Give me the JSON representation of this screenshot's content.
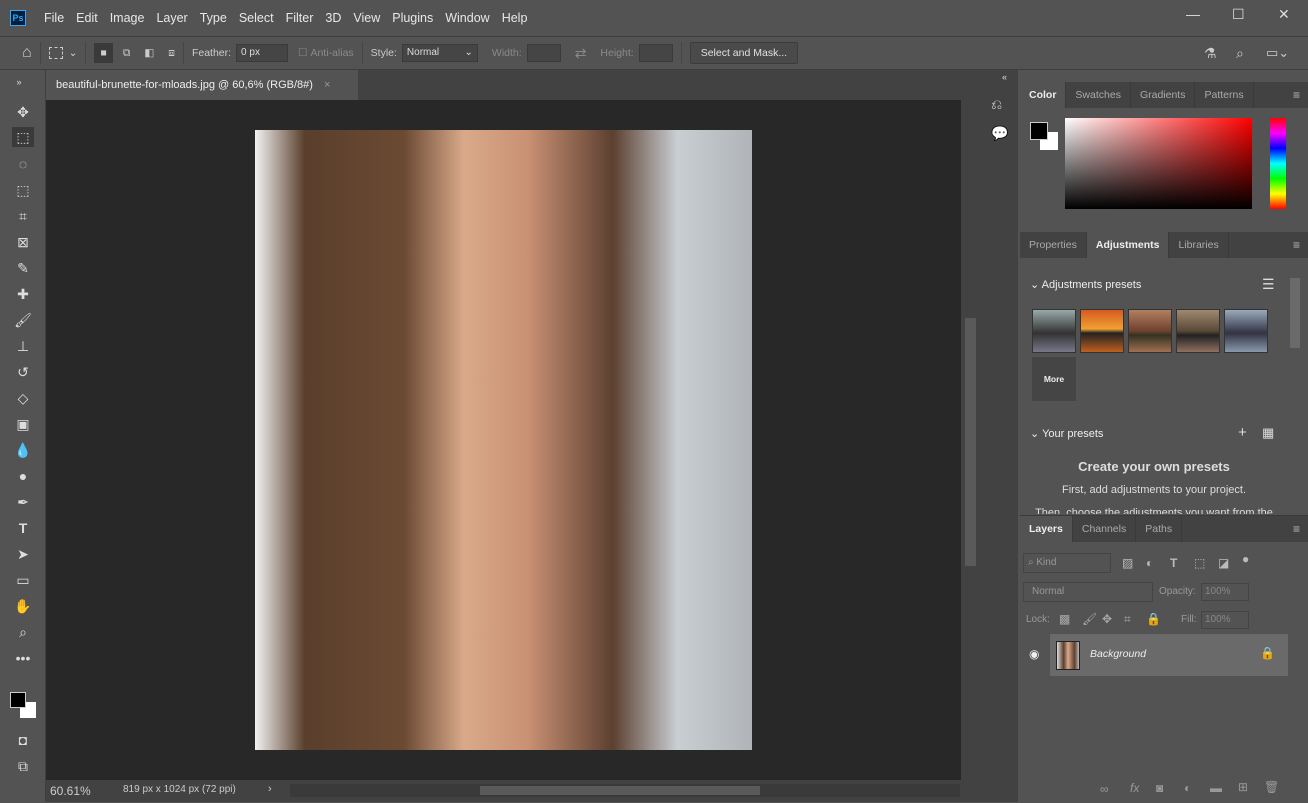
{
  "menubar": {
    "logo": "Ps",
    "items": [
      "File",
      "Edit",
      "Image",
      "Layer",
      "Type",
      "Select",
      "Filter",
      "3D",
      "View",
      "Plugins",
      "Window",
      "Help"
    ]
  },
  "options": {
    "feather_label": "Feather:",
    "feather_value": "0 px",
    "antialias_label": "Anti-alias",
    "style_label": "Style:",
    "style_value": "Normal",
    "width_label": "Width:",
    "height_label": "Height:",
    "select_mask": "Select and Mask..."
  },
  "document": {
    "tab_title": "beautiful-brunette-for-mloads.jpg @ 60,6% (RGB/8#)",
    "close": "×"
  },
  "status": {
    "zoom": "60.61%",
    "info": "819 px x 1024 px (72 ppi)",
    "arrow": "›"
  },
  "color_panel": {
    "tabs": [
      "Color",
      "Swatches",
      "Gradients",
      "Patterns"
    ]
  },
  "adj_panel": {
    "tabs": [
      "Properties",
      "Adjustments",
      "Libraries"
    ],
    "presets_title": "Adjustments presets",
    "more": "More",
    "your_presets": "Your presets",
    "create_title": "Create your own presets",
    "create_line1": "First, add adjustments to your project.",
    "create_line2": "Then, choose the adjustments you want from the"
  },
  "layers_panel": {
    "tabs": [
      "Layers",
      "Channels",
      "Paths"
    ],
    "kind": "Kind",
    "blend": "Normal",
    "opacity_label": "Opacity:",
    "opacity_value": "100%",
    "lock_label": "Lock:",
    "fill_label": "Fill:",
    "fill_value": "100%",
    "layer_name": "Background"
  }
}
